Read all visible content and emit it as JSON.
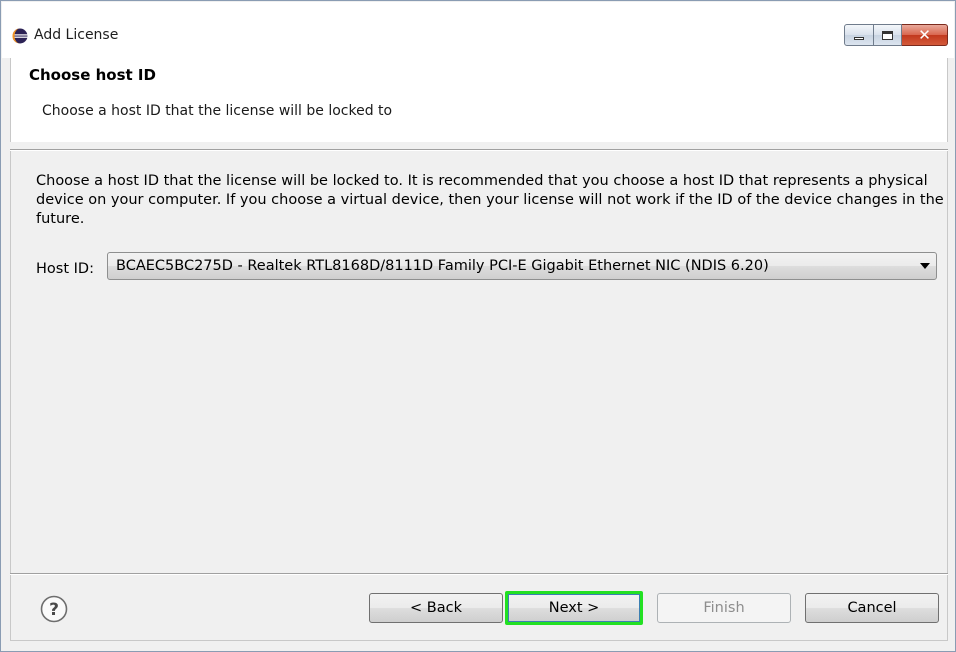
{
  "window": {
    "title": "Add License",
    "icon": "eclipse-icon"
  },
  "header": {
    "title": "Choose host ID",
    "description": "Choose a host ID that the license will be locked to"
  },
  "body": {
    "instructions": "Choose a host ID that the license will be locked to. It is recommended that you choose a host ID that represents a physical device on your computer. If you choose a virtual device, then your license will not work if the ID of the device changes in the future.",
    "host_id_label": "Host ID:",
    "host_id_value": "BCAEC5BC275D - Realtek RTL8168D/8111D Family PCI-E Gigabit Ethernet NIC (NDIS 6.20)"
  },
  "footer": {
    "help_icon": "help-icon",
    "back_label": "< Back",
    "next_label": "Next >",
    "finish_label": "Finish",
    "cancel_label": "Cancel"
  },
  "colors": {
    "focus_highlight": "#22e022",
    "close_button": "#c2391e",
    "background": "#f0f0f0"
  }
}
